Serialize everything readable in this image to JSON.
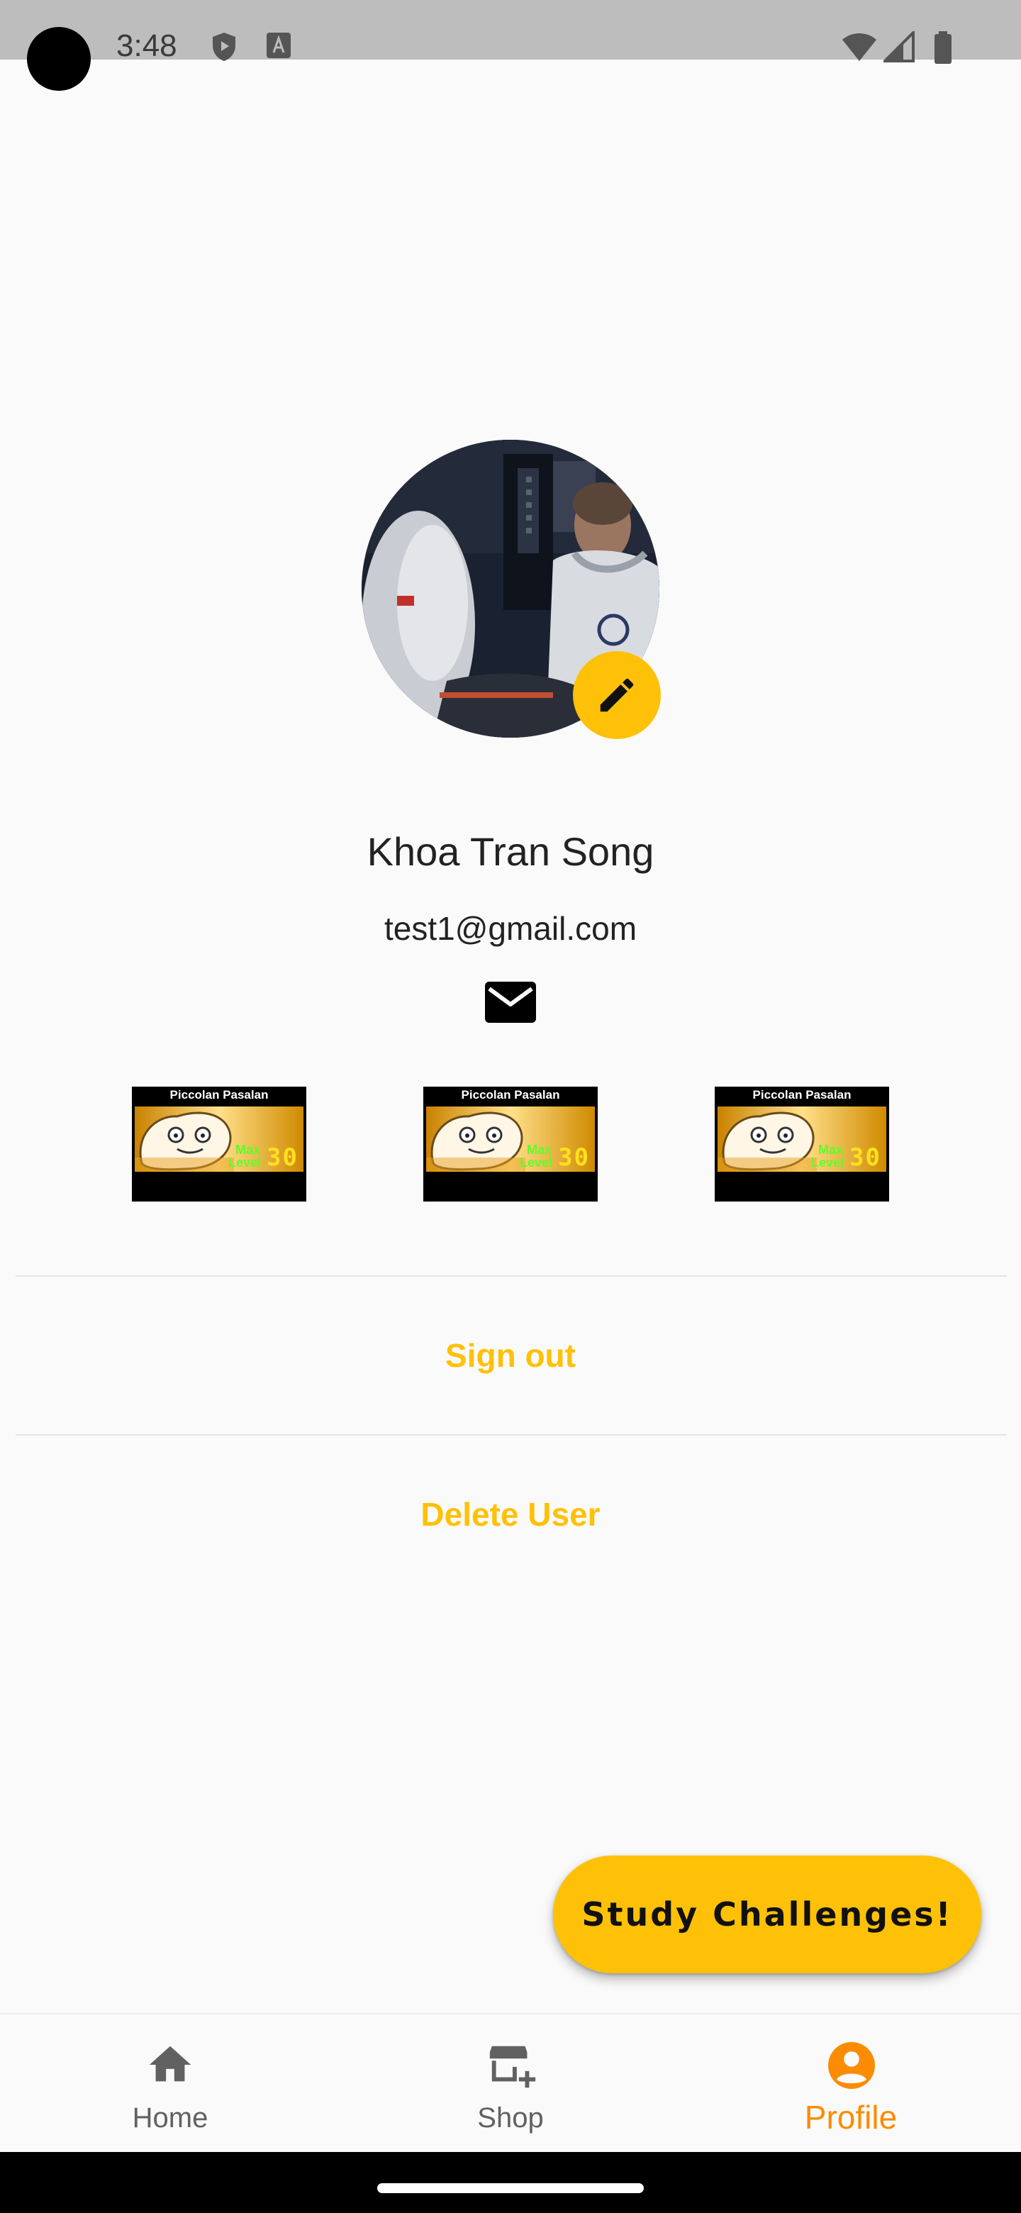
{
  "status_bar": {
    "time": "3:48"
  },
  "profile": {
    "name": "Khoa Tran Song",
    "email": "test1@gmail.com"
  },
  "badges": [
    {
      "title": "Piccolan Pasalan",
      "level_label_1": "Max",
      "level_label_2": "Level",
      "level": "30"
    },
    {
      "title": "Piccolan Pasalan",
      "level_label_1": "Max",
      "level_label_2": "Level",
      "level": "30"
    },
    {
      "title": "Piccolan Pasalan",
      "level_label_1": "Max",
      "level_label_2": "Level",
      "level": "30"
    }
  ],
  "actions": {
    "sign_out": "Sign out",
    "delete_user": "Delete User"
  },
  "fab": {
    "label": "Study Challenges!"
  },
  "nav": {
    "items": [
      {
        "label": "Home",
        "icon": "home-icon"
      },
      {
        "label": "Shop",
        "icon": "store-add-icon"
      },
      {
        "label": "Profile",
        "icon": "account-circle-icon",
        "active": true
      }
    ]
  },
  "colors": {
    "accent": "#ffc107",
    "active_nav": "#fb8c00",
    "inactive_nav": "#616161",
    "background": "#fafafa"
  }
}
